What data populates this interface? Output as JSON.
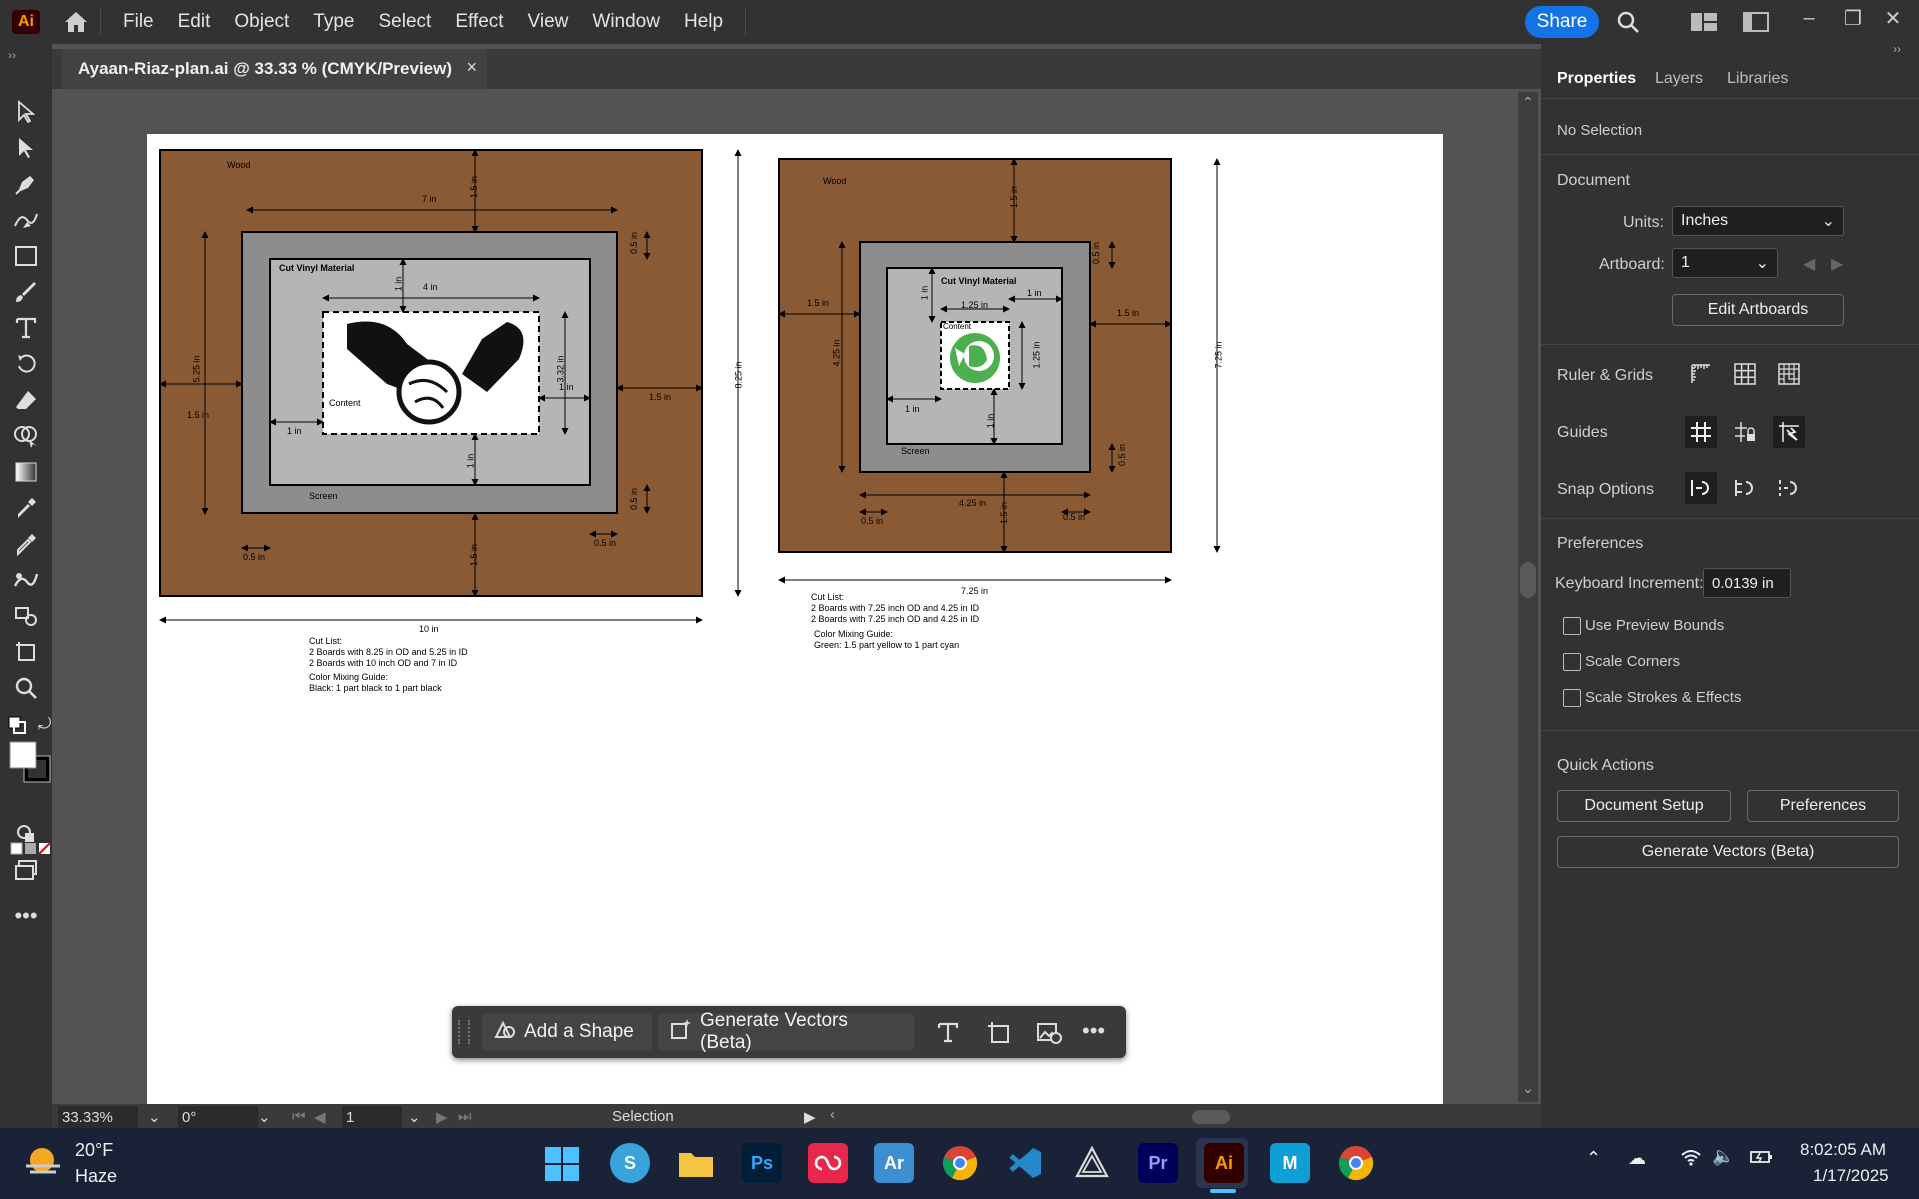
{
  "app": {
    "logo": "Ai",
    "menu": [
      "File",
      "Edit",
      "Object",
      "Type",
      "Select",
      "Effect",
      "View",
      "Window",
      "Help"
    ],
    "share_label": "Share"
  },
  "document": {
    "tab_title": "Ayaan-Riaz-plan.ai @ 33.33 % (CMYK/Preview)",
    "close_glyph": "×"
  },
  "drawing": {
    "left": {
      "wood": "Wood",
      "cut_vinyl": "Cut Vinyl Material",
      "content": "Content",
      "screen": "Screen",
      "dims": {
        "top_15": "1.5 in",
        "w7": "7 in",
        "top_05": "0.5 in",
        "in1_top": "1 in",
        "w4": "4 in",
        "h525": "5.25 in",
        "left_15": "1.5 in",
        "left_1": "1 in",
        "h332": "3.32 in",
        "right_1": "1 in",
        "right_15": "1.5 in",
        "bot_1": "1 in",
        "right_05": "0.5 in",
        "bl_05": "0.5 in",
        "bot_15": "1.5 in",
        "br_05": "0.5 in",
        "w10": "10 in",
        "h825": "8.25 in"
      },
      "notes": [
        "Cut List:",
        "2 Boards with 8.25 in OD and 5.25 in ID",
        "2 Boards with 10 inch OD and 7 in ID",
        "Color Mixing Guide:",
        "Black: 1 part black to 1 part black"
      ]
    },
    "right": {
      "wood": "Wood",
      "cut_vinyl": "Cut Vinyl Material",
      "content": "Content",
      "screen": "Screen",
      "dims": {
        "top_15": "1.5 in",
        "top_05": "0.5 in",
        "in1_left": "1 in",
        "w125": "1.25 in",
        "in1_right": "1 in",
        "left_15": "1.5 in",
        "h425": "4.25 in",
        "h125": "1.25 in",
        "right_15": "1.5 in",
        "left_1": "1 in",
        "bot_1": "1 in",
        "bot_right_05": "0.5 in",
        "w425": "4.25 in",
        "bot_15": "1.5 in",
        "bl_05": "0.5 in",
        "br_05": "0.5 in",
        "w725": "7.25 in",
        "h725": "7.25 in"
      },
      "notes": [
        "Cut List:",
        "2 Boards with 7.25 inch OD and 4.25 in ID",
        "2 Boards with 7.25 inch OD and 4.25 in ID",
        "Color Mixing Guide:",
        "Green: 1.5 part yellow to 1 part cyan"
      ]
    }
  },
  "panel": {
    "tabs": [
      "Properties",
      "Layers",
      "Libraries"
    ],
    "no_selection": "No Selection",
    "document_label": "Document",
    "units_label": "Units:",
    "units_value": "Inches",
    "artboard_label": "Artboard:",
    "artboard_value": "1",
    "edit_artboards": "Edit Artboards",
    "ruler_grids": "Ruler & Grids",
    "guides": "Guides",
    "snap_options": "Snap Options",
    "preferences_label": "Preferences",
    "keyboard_increment_label": "Keyboard Increment:",
    "keyboard_increment_value": "0.0139 in",
    "use_preview_bounds": "Use Preview Bounds",
    "scale_corners": "Scale Corners",
    "scale_strokes": "Scale Strokes & Effects",
    "quick_actions": "Quick Actions",
    "document_setup": "Document Setup",
    "preferences_btn": "Preferences",
    "generate_vectors": "Generate Vectors (Beta)"
  },
  "context_bar": {
    "add_shape": "Add a Shape",
    "generate_vectors": "Generate Vectors (Beta)"
  },
  "status": {
    "zoom": "33.33%",
    "rotation": "0°",
    "artboard": "1",
    "tool": "Selection"
  },
  "taskbar": {
    "weather_temp": "20°F",
    "weather_desc": "Haze",
    "time": "8:02:05 AM",
    "date": "1/17/2025",
    "apps": [
      "Ps",
      "Ar",
      "Pr",
      "Ai"
    ],
    "maya_label": "M"
  }
}
